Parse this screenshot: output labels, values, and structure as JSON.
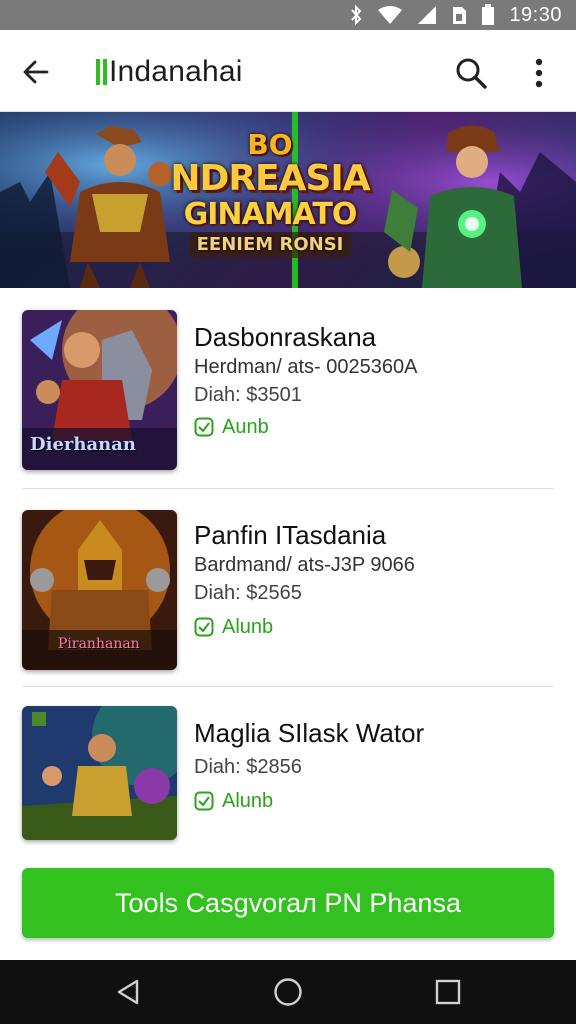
{
  "status_bar": {
    "time": "19:30",
    "icons": [
      "bluetooth-icon",
      "wifi-icon",
      "signal-icon",
      "sim-icon",
      "battery-icon"
    ]
  },
  "app_bar": {
    "title": "Indanahai",
    "icons": [
      "back-arrow-icon",
      "search-icon",
      "more-vert-icon"
    ]
  },
  "banner": {
    "line1": "BO",
    "line2": "NDREASIA",
    "line3": "GINAMATO",
    "line4": "EENIEM RONSI"
  },
  "items": [
    {
      "title": "Dasbonraskana",
      "subtitle": "Herdman/ ats- 0025360A",
      "price": "Diah: $3501",
      "status": "Aunb",
      "thumb_caption": "Dierhanan"
    },
    {
      "title": "Panfin ITasdania",
      "subtitle": "Bardmand/ ats-J3P 9066",
      "price": "Diah: $2565",
      "status": "Alunb",
      "thumb_caption": "Piranhanan"
    },
    {
      "title": "Maglia SIlask Wator",
      "subtitle": "",
      "price": "Diah: $2856",
      "status": "Alunb",
      "thumb_caption": ""
    }
  ],
  "cta": {
    "label": "Tools Casgvoraл PN Phansa"
  },
  "colors": {
    "accent": "#33c11f",
    "status_green": "#2aa31c",
    "status_bar": "#7a7a7a",
    "nav_bar": "#101010"
  },
  "nav_bar": {
    "icons": [
      "back-triangle-icon",
      "home-circle-icon",
      "recents-square-icon"
    ]
  }
}
